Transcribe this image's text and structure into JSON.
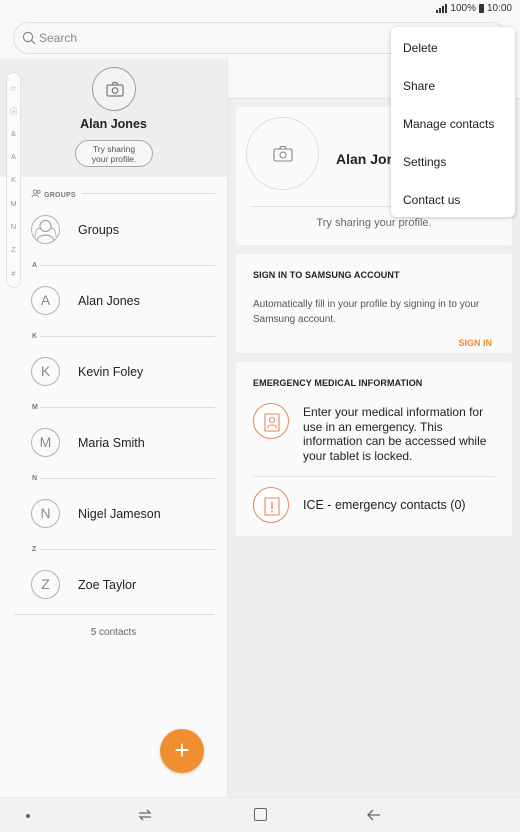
{
  "status_bar": {
    "battery": "100%",
    "time": "10:00"
  },
  "search": {
    "placeholder": "Search"
  },
  "profile": {
    "name": "Alan Jones",
    "share_line1": "Try sharing",
    "share_line2": "your profile."
  },
  "index_letters": [
    "☆",
    "ⓐ",
    "&",
    "A",
    "K",
    "M",
    "N",
    "Z",
    "#"
  ],
  "groups": {
    "header": "GROUPS",
    "label": "Groups"
  },
  "contacts": [
    {
      "section": "A",
      "initial": "A",
      "name": "Alan Jones"
    },
    {
      "section": "K",
      "initial": "K",
      "name": "Kevin Foley"
    },
    {
      "section": "M",
      "initial": "M",
      "name": "Maria Smith"
    },
    {
      "section": "N",
      "initial": "N",
      "name": "Nigel Jameson"
    },
    {
      "section": "Z",
      "initial": "Z",
      "name": "Zoe Taylor"
    }
  ],
  "contacts_count": "5 contacts",
  "fab": {
    "label": "+"
  },
  "detail": {
    "profile_name": "Alan Jones",
    "try_sharing": "Try sharing your profile.",
    "samsung": {
      "title": "SIGN IN TO SAMSUNG ACCOUNT",
      "text": "Automatically fill in your profile by signing in to your Samsung account.",
      "button": "SIGN IN"
    },
    "emergency": {
      "title": "EMERGENCY MEDICAL INFORMATION",
      "medical_text": "Enter your medical information for use in an emergency. This information can be accessed while your tablet is locked.",
      "ice_text": "ICE - emergency contacts (0)"
    }
  },
  "menu": {
    "items": [
      "Delete",
      "Share",
      "Manage contacts",
      "Settings",
      "Contact us"
    ]
  },
  "colors": {
    "accent": "#f08f30",
    "emergency_icon": "#e8865a"
  }
}
